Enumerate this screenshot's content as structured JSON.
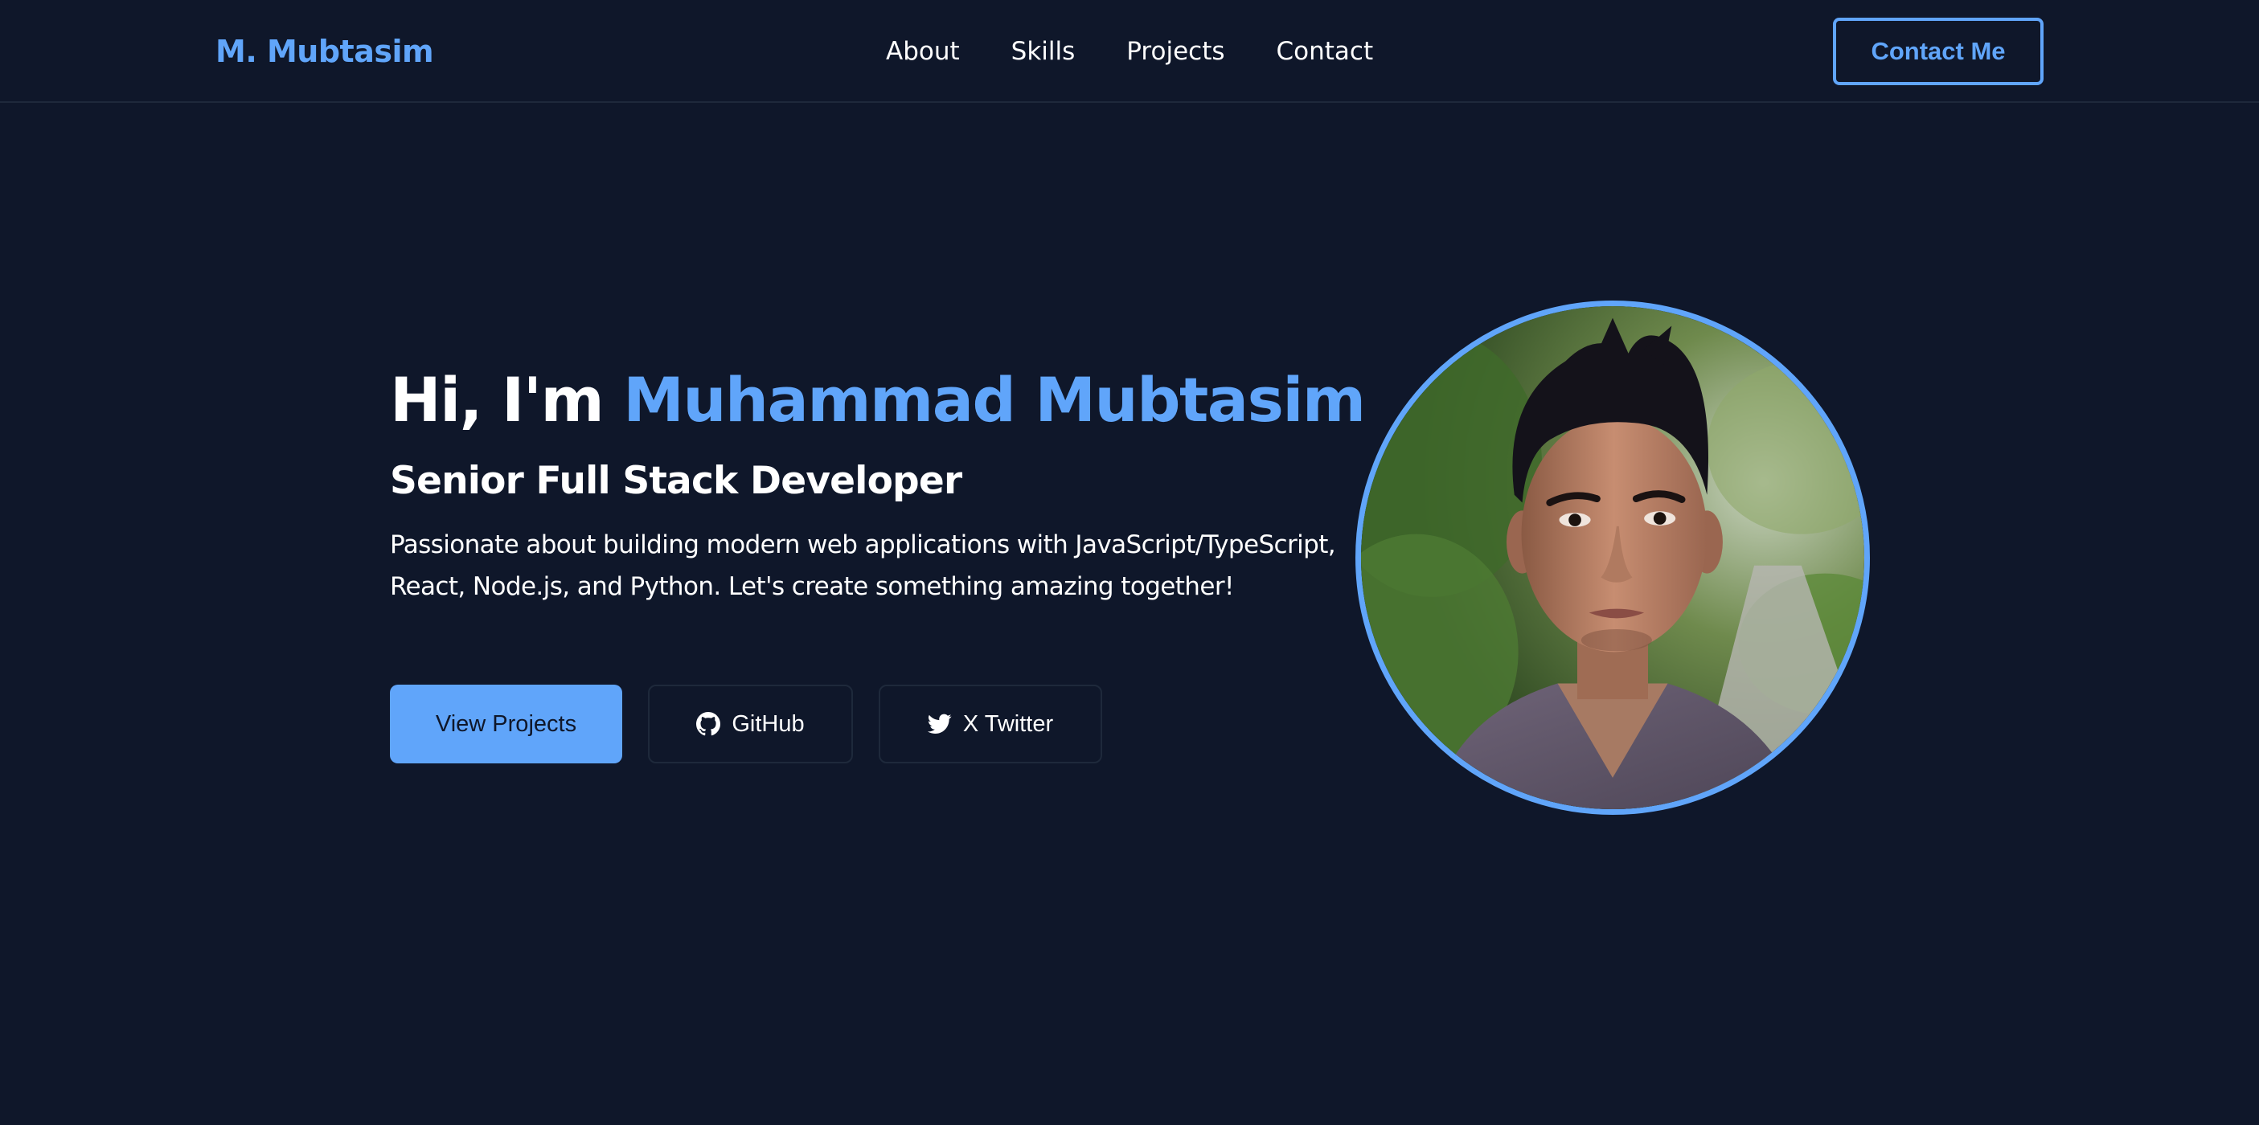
{
  "header": {
    "brand": "M. Mubtasim",
    "nav": [
      {
        "label": "About"
      },
      {
        "label": "Skills"
      },
      {
        "label": "Projects"
      },
      {
        "label": "Contact"
      }
    ],
    "cta_label": "Contact Me"
  },
  "hero": {
    "greeting": "Hi, I'm ",
    "name": "Muhammad Mubtasim",
    "role": "Senior Full Stack Developer",
    "description": "Passionate about building modern web applications with JavaScript/TypeScript, React, Node.js, and Python. Let's create something amazing together!",
    "buttons": {
      "projects_label": "View Projects",
      "github_label": "GitHub",
      "twitter_label": "X Twitter"
    },
    "icons": {
      "github": "github-icon",
      "twitter": "twitter-icon"
    },
    "avatar": {
      "icon": "profile-photo"
    }
  },
  "colors": {
    "background": "#0f172a",
    "accent": "#60a5fa",
    "border": "#1e293b",
    "text": "#ffffff"
  }
}
